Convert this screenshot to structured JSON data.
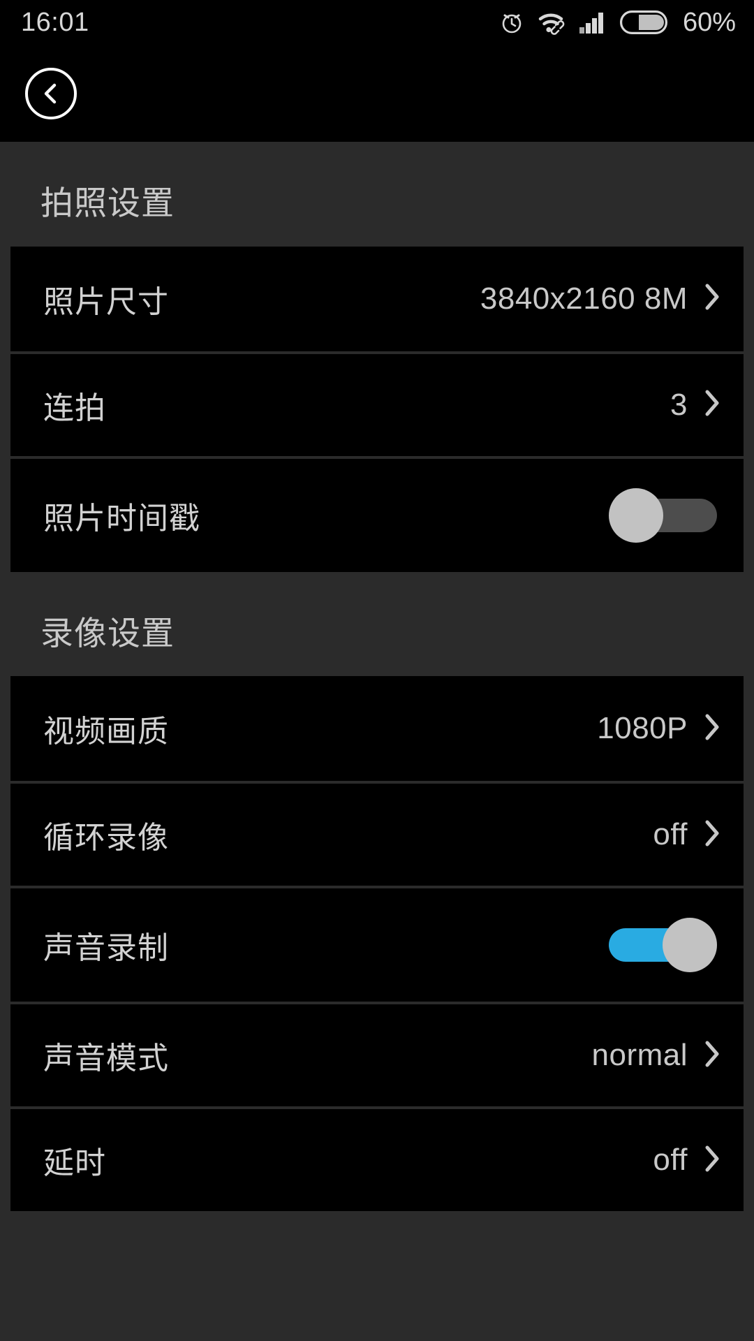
{
  "status_bar": {
    "time": "16:01",
    "battery_percent": "60%",
    "icons": [
      "alarm-icon",
      "wifi-icon",
      "signal-icon",
      "battery-icon"
    ]
  },
  "app_bar": {
    "back_label": "back-button"
  },
  "colors": {
    "background": "#2b2b2b",
    "card": "#000000",
    "text": "#d2d2d2",
    "value_text": "#c9c9c9",
    "toggle_on": "#29abe2",
    "toggle_off_track": "#4d4d4d",
    "toggle_knob": "#c2c2c2"
  },
  "sections": [
    {
      "title": "拍照设置",
      "rows": [
        {
          "label": "照片尺寸",
          "value": "3840x2160 8M",
          "type": "value"
        },
        {
          "label": "连拍",
          "value": "3",
          "type": "value"
        },
        {
          "label": "照片时间戳",
          "value": "off",
          "type": "toggle",
          "checked": false
        }
      ]
    },
    {
      "title": "录像设置",
      "rows": [
        {
          "label": "视频画质",
          "value": "1080P",
          "type": "value"
        },
        {
          "label": "循环录像",
          "value": "off",
          "type": "value"
        },
        {
          "label": "声音录制",
          "value": "on",
          "type": "toggle",
          "checked": true
        },
        {
          "label": "声音模式",
          "value": "normal",
          "type": "value"
        },
        {
          "label": "延时",
          "value": "off",
          "type": "value"
        }
      ]
    }
  ]
}
